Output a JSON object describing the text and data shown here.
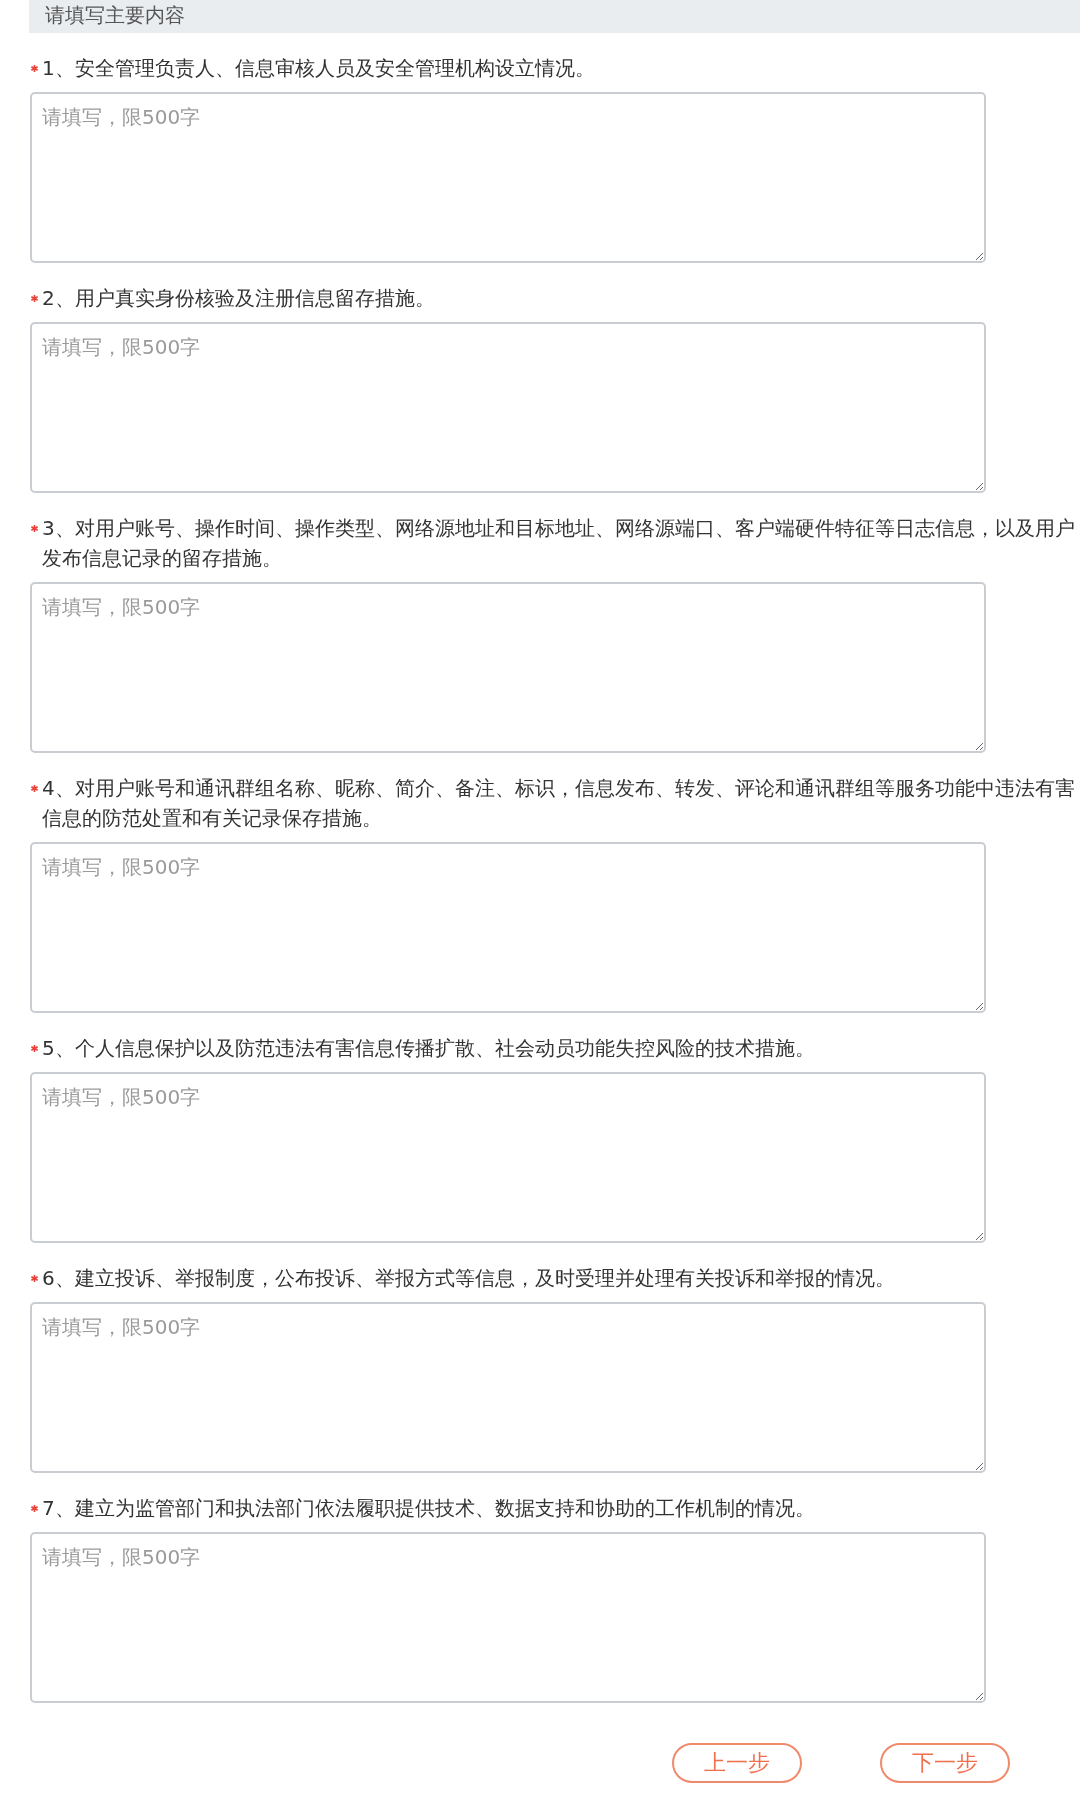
{
  "section_title": "请填写主要内容",
  "questions": [
    {
      "label": "1、安全管理负责人、信息审核人员及安全管理机构设立情况。",
      "required": true,
      "placeholder": "请填写，限500字"
    },
    {
      "label": "2、用户真实身份核验及注册信息留存措施。",
      "required": true,
      "placeholder": "请填写，限500字"
    },
    {
      "label": "3、对用户账号、操作时间、操作类型、网络源地址和目标地址、网络源端口、客户端硬件特征等日志信息，以及用户发布信息记录的留存措施。",
      "required": true,
      "placeholder": "请填写，限500字"
    },
    {
      "label": "4、对用户账号和通讯群组名称、昵称、简介、备注、标识，信息发布、转发、评论和通讯群组等服务功能中违法有害信息的防范处置和有关记录保存措施。",
      "required": true,
      "placeholder": "请填写，限500字"
    },
    {
      "label": "5、个人信息保护以及防范违法有害信息传播扩散、社会动员功能失控风险的技术措施。",
      "required": true,
      "placeholder": "请填写，限500字"
    },
    {
      "label": "6、建立投诉、举报制度，公布投诉、举报方式等信息，及时受理并处理有关投诉和举报的情况。",
      "required": true,
      "placeholder": "请填写，限500字"
    },
    {
      "label": "7、建立为监管部门和执法部门依法履职提供技术、数据支持和协助的工作机制的情况。",
      "required": true,
      "placeholder": "请填写，限500字"
    }
  ],
  "buttons": [
    "上一步",
    "下一步"
  ]
}
